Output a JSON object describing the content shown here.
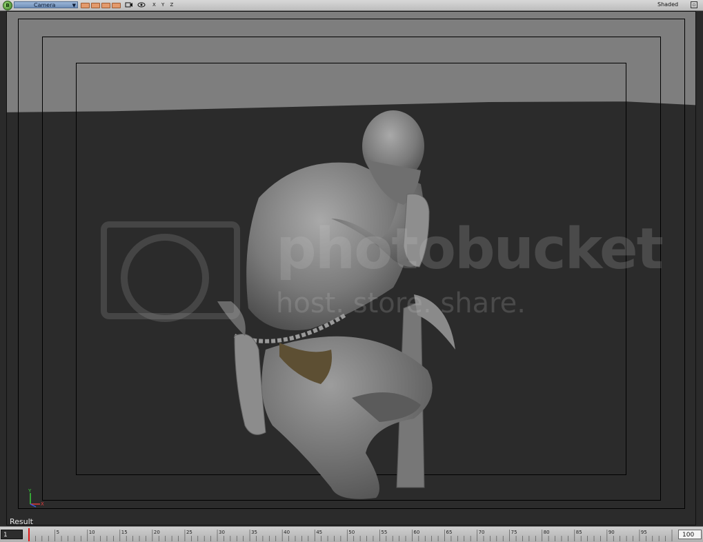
{
  "toolbar": {
    "logo": "B",
    "camera_label": "Camera",
    "axis_labels": "X Y Z",
    "shade_mode": "Shaded",
    "swatch_color": "#e39a6c",
    "icons": [
      "camera-icon",
      "eye-icon",
      "maximize-icon"
    ]
  },
  "viewport": {
    "result_label": "Result",
    "watermark_line1": "photobucket",
    "watermark_line2": "host. store. share.",
    "axis_gizmo": {
      "y": "Y",
      "x": "X"
    }
  },
  "timeline": {
    "start_frame": "1",
    "end_frame": "100",
    "current_frame": 1,
    "ticks": [
      5,
      10,
      15,
      20,
      25,
      30,
      35,
      40,
      45,
      50,
      55,
      60,
      65,
      70,
      75,
      80,
      85,
      90,
      95
    ]
  }
}
